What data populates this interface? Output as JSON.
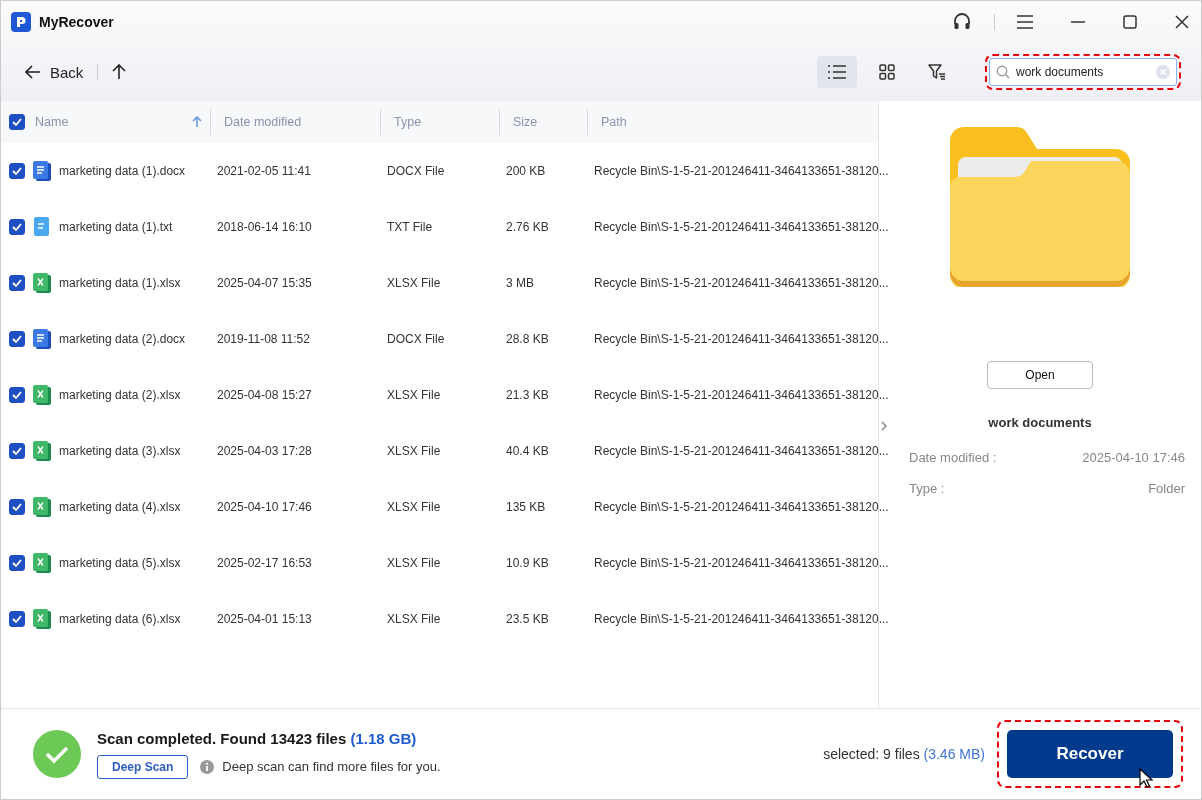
{
  "window": {
    "title": "MyRecover"
  },
  "toolbar": {
    "back": "Back",
    "views": [
      {
        "kind": "list",
        "selected": true
      },
      {
        "kind": "grid",
        "selected": false
      }
    ],
    "search": {
      "value": "work documents",
      "highlighted": true
    }
  },
  "table": {
    "all_checked": true,
    "columns": [
      {
        "label": "Name",
        "sorted": true
      },
      {
        "label": "Date modified",
        "sorted": false
      },
      {
        "label": "Type",
        "sorted": false
      },
      {
        "label": "Size",
        "sorted": false
      },
      {
        "label": "Path",
        "sorted": false
      }
    ],
    "rows": [
      {
        "kind": "docx",
        "checked": true,
        "name": "marketing data (1).docx",
        "date": "2021-02-05 11:41",
        "type": "DOCX File",
        "size": "200 KB",
        "path": "Recycle Bin\\S-1-5-21-201246411-3464133651-38120..."
      },
      {
        "kind": "txt",
        "checked": true,
        "name": "marketing data (1).txt",
        "date": "2018-06-14 16:10",
        "type": "TXT File",
        "size": "2.76 KB",
        "path": "Recycle Bin\\S-1-5-21-201246411-3464133651-38120..."
      },
      {
        "kind": "xlsx",
        "checked": true,
        "name": "marketing data (1).xlsx",
        "date": "2025-04-07 15:35",
        "type": "XLSX File",
        "size": "3 MB",
        "path": "Recycle Bin\\S-1-5-21-201246411-3464133651-38120..."
      },
      {
        "kind": "docx",
        "checked": true,
        "name": "marketing data (2).docx",
        "date": "2019-11-08 11:52",
        "type": "DOCX File",
        "size": "28.8 KB",
        "path": "Recycle Bin\\S-1-5-21-201246411-3464133651-38120..."
      },
      {
        "kind": "xlsx",
        "checked": true,
        "name": "marketing data (2).xlsx",
        "date": "2025-04-08 15:27",
        "type": "XLSX File",
        "size": "21.3 KB",
        "path": "Recycle Bin\\S-1-5-21-201246411-3464133651-38120..."
      },
      {
        "kind": "xlsx",
        "checked": true,
        "name": "marketing data (3).xlsx",
        "date": "2025-04-03 17:28",
        "type": "XLSX File",
        "size": "40.4 KB",
        "path": "Recycle Bin\\S-1-5-21-201246411-3464133651-38120..."
      },
      {
        "kind": "xlsx",
        "checked": true,
        "name": "marketing data (4).xlsx",
        "date": "2025-04-10 17:46",
        "type": "XLSX File",
        "size": "135 KB",
        "path": "Recycle Bin\\S-1-5-21-201246411-3464133651-38120..."
      },
      {
        "kind": "xlsx",
        "checked": true,
        "name": "marketing data (5).xlsx",
        "date": "2025-02-17 16:53",
        "type": "XLSX File",
        "size": "10.9 KB",
        "path": "Recycle Bin\\S-1-5-21-201246411-3464133651-38120..."
      },
      {
        "kind": "xlsx",
        "checked": true,
        "name": "marketing data (6).xlsx",
        "date": "2025-04-01 15:13",
        "type": "XLSX File",
        "size": "23.5 KB",
        "path": "Recycle Bin\\S-1-5-21-201246411-3464133651-38120..."
      }
    ]
  },
  "preview": {
    "open_button": "Open",
    "name": "work documents",
    "details": [
      {
        "label": "Date modified :",
        "value": "2025-04-10 17:46"
      },
      {
        "label": "Type :",
        "value": "Folder"
      }
    ]
  },
  "footer": {
    "message": "Scan completed. Found 13423 files",
    "found_size": "(1.18 GB)",
    "deep_scan_button": "Deep Scan",
    "hint": "Deep scan can find more files for you.",
    "selected": "selected: 9 files",
    "selected_size": "(3.46 MB)",
    "recover_button": {
      "label": "Recover",
      "highlighted": true
    }
  }
}
